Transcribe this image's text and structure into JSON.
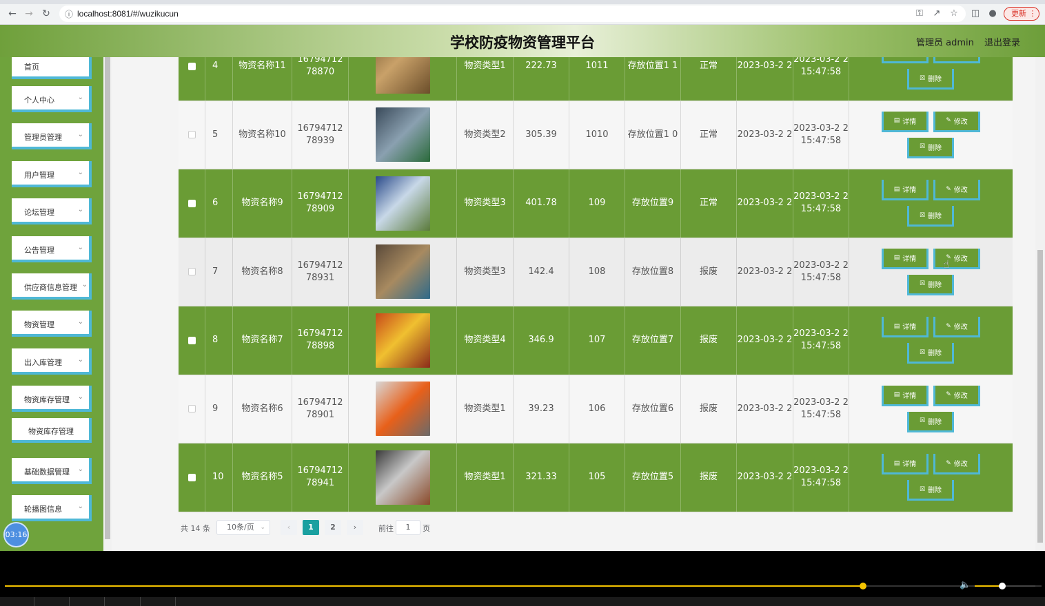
{
  "browser": {
    "url": "localhost:8081/#/wuzikucun",
    "update_label": "更新"
  },
  "header": {
    "title": "学校防疫物资管理平台",
    "user_label": "管理员 admin",
    "logout_label": "退出登录"
  },
  "sidebar": {
    "items": [
      {
        "label": "首页"
      },
      {
        "label": "个人中心"
      },
      {
        "label": "管理员管理"
      },
      {
        "label": "用户管理"
      },
      {
        "label": "论坛管理"
      },
      {
        "label": "公告管理"
      },
      {
        "label": "供应商信息管理"
      },
      {
        "label": "物资管理"
      },
      {
        "label": "出入库管理"
      },
      {
        "label": "物资库存管理"
      },
      {
        "label": "物资库存管理"
      },
      {
        "label": "基础数据管理"
      },
      {
        "label": "轮播图信息"
      }
    ],
    "timer": "03:16"
  },
  "table": {
    "rows": [
      {
        "idx": "4",
        "name": "物资名称11",
        "code": "16794712 78870",
        "type": "物资类型1",
        "price": "222.73",
        "qty": "1011",
        "location": "存放位置1 1",
        "status": "正常",
        "date1": "2023-03-2 2",
        "date2": "2023-03-2 2 15:47:58"
      },
      {
        "idx": "5",
        "name": "物资名称10",
        "code": "16794712 78939",
        "type": "物资类型2",
        "price": "305.39",
        "qty": "1010",
        "location": "存放位置1 0",
        "status": "正常",
        "date1": "2023-03-2 2",
        "date2": "2023-03-2 2 15:47:58"
      },
      {
        "idx": "6",
        "name": "物资名称9",
        "code": "16794712 78909",
        "type": "物资类型3",
        "price": "401.78",
        "qty": "109",
        "location": "存放位置9",
        "status": "正常",
        "date1": "2023-03-2 2",
        "date2": "2023-03-2 2 15:47:58"
      },
      {
        "idx": "7",
        "name": "物资名称8",
        "code": "16794712 78931",
        "type": "物资类型3",
        "price": "142.4",
        "qty": "108",
        "location": "存放位置8",
        "status": "报废",
        "date1": "2023-03-2 2",
        "date2": "2023-03-2 2 15:47:58"
      },
      {
        "idx": "8",
        "name": "物资名称7",
        "code": "16794712 78898",
        "type": "物资类型4",
        "price": "346.9",
        "qty": "107",
        "location": "存放位置7",
        "status": "报废",
        "date1": "2023-03-2 2",
        "date2": "2023-03-2 2 15:47:58"
      },
      {
        "idx": "9",
        "name": "物资名称6",
        "code": "16794712 78901",
        "type": "物资类型1",
        "price": "39.23",
        "qty": "106",
        "location": "存放位置6",
        "status": "报废",
        "date1": "2023-03-2 2",
        "date2": "2023-03-2 2 15:47:58"
      },
      {
        "idx": "10",
        "name": "物资名称5",
        "code": "16794712 78941",
        "type": "物资类型1",
        "price": "321.33",
        "qty": "105",
        "location": "存放位置5",
        "status": "报废",
        "date1": "2023-03-2 2",
        "date2": "2023-03-2 2 15:47:58"
      }
    ],
    "op_detail": "详情",
    "op_edit": "修改",
    "op_delete": "删除"
  },
  "pager": {
    "total": "共 14 条",
    "page_size": "10条/页",
    "pages": [
      "1",
      "2"
    ],
    "current": "1",
    "goto_label": "前往",
    "goto_value": "1",
    "page_word": "页"
  },
  "player": {
    "progress": 0.828,
    "volume": 0.45
  },
  "colors": {
    "green": "#6a9c35",
    "accent": "#4fb8d6",
    "teal": "#1aa0a0"
  }
}
